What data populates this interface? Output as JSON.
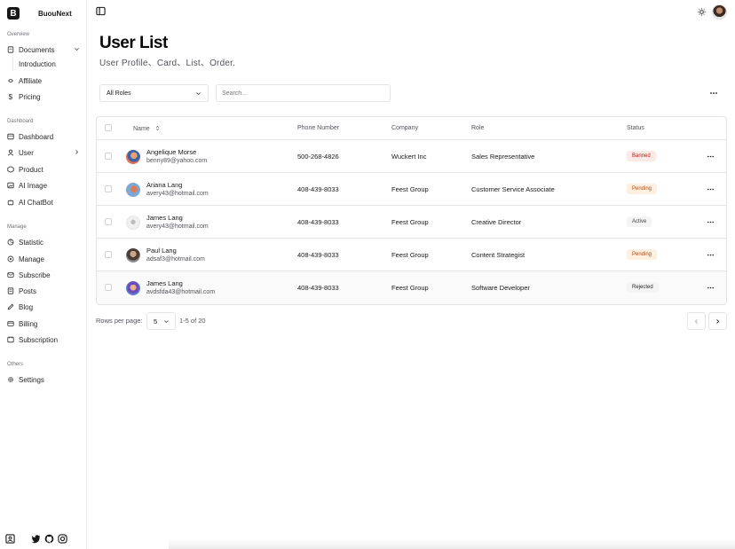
{
  "brand": {
    "logo_letter": "B",
    "name": "BuouNext"
  },
  "sidebar": {
    "groups": [
      {
        "label": "Overview"
      },
      {
        "label": "Dashboard"
      },
      {
        "label": "Manage"
      },
      {
        "label": "Others"
      }
    ],
    "items": [
      {
        "label": "Documents",
        "icon": "document-icon"
      },
      {
        "label": "Introduction"
      },
      {
        "label": "Affiliate",
        "icon": "affiliate-icon"
      },
      {
        "label": "Pricing",
        "icon": "dollar-icon"
      },
      {
        "label": "Dashboard",
        "icon": "dashboard-icon"
      },
      {
        "label": "User",
        "icon": "user-icon"
      },
      {
        "label": "Product",
        "icon": "box-icon"
      },
      {
        "label": "AI Image",
        "icon": "image-icon"
      },
      {
        "label": "AI ChatBot",
        "icon": "bot-icon"
      },
      {
        "label": "Statistic",
        "icon": "chart-icon"
      },
      {
        "label": "Manage",
        "icon": "manage-icon"
      },
      {
        "label": "Subscribe",
        "icon": "mail-icon"
      },
      {
        "label": "Posts",
        "icon": "posts-icon"
      },
      {
        "label": "Blog",
        "icon": "blog-icon"
      },
      {
        "label": "Billing",
        "icon": "billing-icon"
      },
      {
        "label": "Subscription",
        "icon": "subscription-icon"
      },
      {
        "label": "Settings",
        "icon": "gear-icon"
      }
    ]
  },
  "page": {
    "title": "User List",
    "subtitle": "User Profile、Card、List、Order."
  },
  "filters": {
    "role_value": "All Roles",
    "search_placeholder": "Search..."
  },
  "table": {
    "columns": {
      "name": "Name",
      "phone": "Phone Number",
      "company": "Company",
      "role": "Role",
      "status": "Status"
    },
    "rows": [
      {
        "name": "Angelique Morse",
        "email": "benny89@yahoo.com",
        "phone": "500-268-4826",
        "company": "Wuckert Inc",
        "role": "Sales Representative",
        "status": "Banned"
      },
      {
        "name": "Ariana Lang",
        "email": "avery43@hotmail.com",
        "phone": "408-439-8033",
        "company": "Feest Group",
        "role": "Customer Service Associate",
        "status": "Pending"
      },
      {
        "name": "James Lang",
        "email": "avery43@hotmail.com",
        "phone": "408-439-8033",
        "company": "Feest Group",
        "role": "Creative Director",
        "status": "Active"
      },
      {
        "name": "Paul Lang",
        "email": "adsaf3@hotmail.com",
        "phone": "408-439-8033",
        "company": "Feest Group",
        "role": "Content Strategist",
        "status": "Pending"
      },
      {
        "name": "James Lang",
        "email": "avdsfda43@hotmail.com",
        "phone": "408-439-8033",
        "company": "Feest Group",
        "role": "Software Developer",
        "status": "Rejected"
      }
    ]
  },
  "pagination": {
    "rows_per_page_label": "Rows per page:",
    "rows_per_page": "5",
    "range": "1-5 of 20"
  },
  "colors": {
    "banned_bg": "#fbe9e7",
    "banned_fg": "#b42318",
    "pending_bg": "#fdf0e1",
    "pending_fg": "#b54708",
    "active_bg": "#f4f4f5",
    "active_fg": "#3f3f46",
    "rejected_bg": "#f4f4f5",
    "rejected_fg": "#27272a"
  }
}
